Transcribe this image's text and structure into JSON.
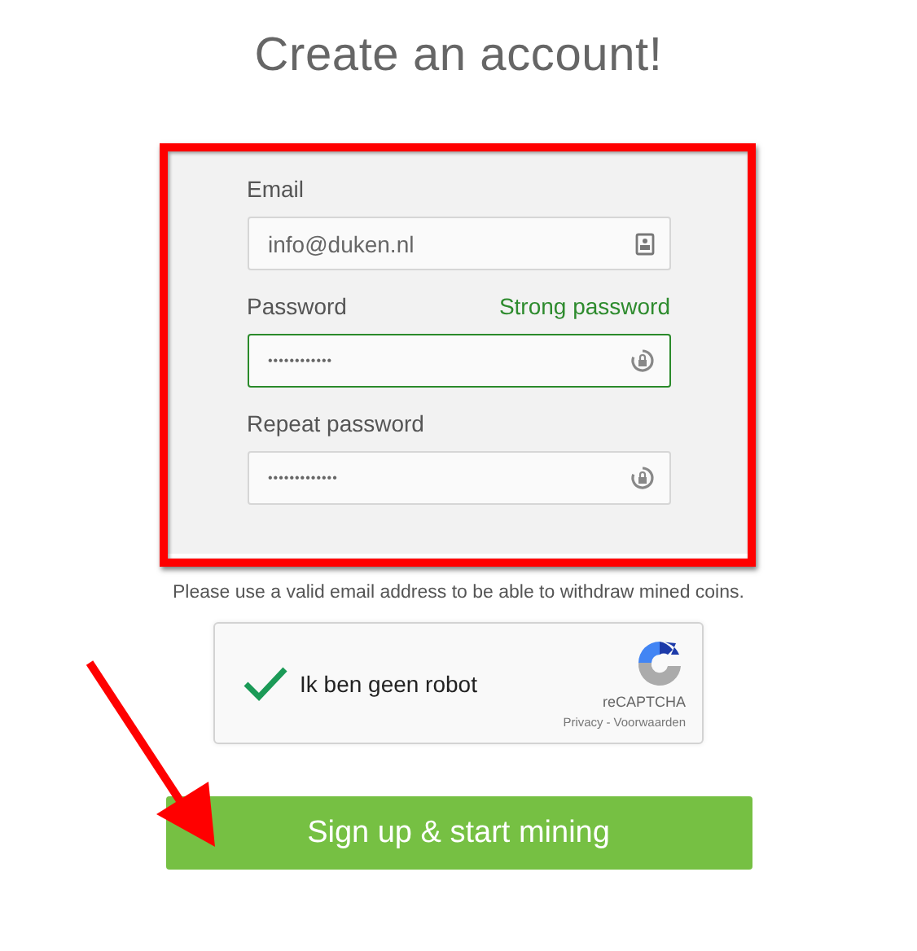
{
  "title": "Create an account!",
  "fields": [
    {
      "label": "Email",
      "value": "info@duken.nl",
      "kind": "email",
      "valid": false
    },
    {
      "label": "Password",
      "value": "••••••••••••",
      "kind": "password",
      "valid": true,
      "status": "Strong password"
    },
    {
      "label": "Repeat password",
      "value": "•••••••••••••",
      "kind": "password",
      "valid": false
    }
  ],
  "note": "Please use a valid email address to be able to withdraw mined coins.",
  "captcha": {
    "checked": true,
    "label": "Ik ben geen robot",
    "brand": "reCAPTCHA",
    "links": [
      "Privacy",
      "-",
      "Voorwaarden"
    ]
  },
  "submit": "Sign up & start mining",
  "annotations": {
    "highlight": true,
    "arrow": true
  }
}
